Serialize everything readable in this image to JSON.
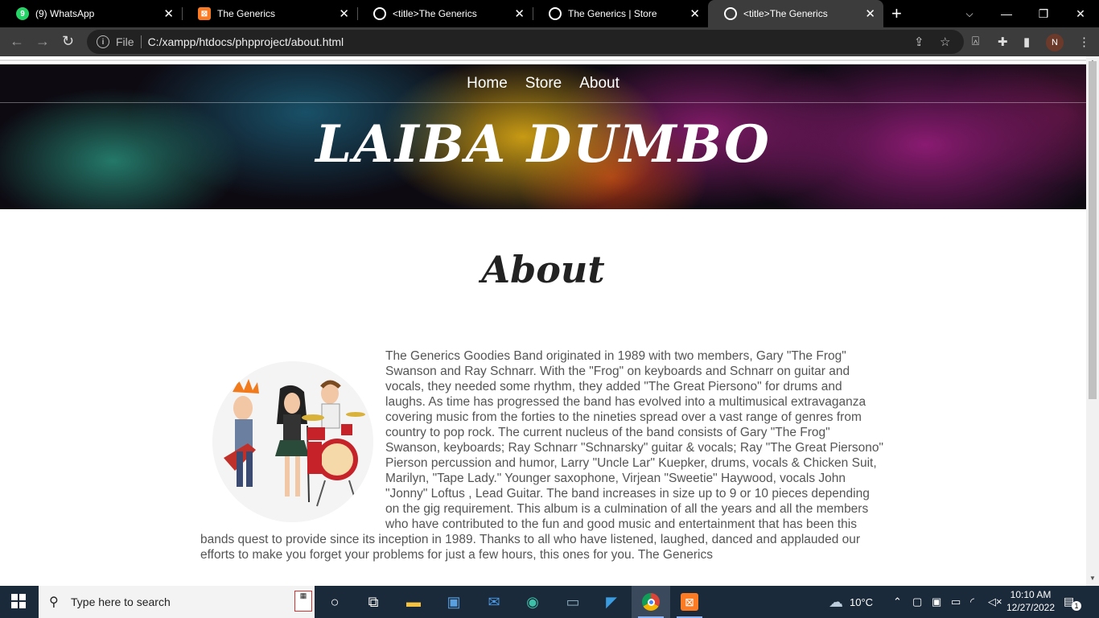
{
  "browser": {
    "tabs": [
      {
        "title": "(9) WhatsApp",
        "badge": "9",
        "favicon": "whatsapp-icon"
      },
      {
        "title": "The Generics",
        "favicon": "xampp-icon"
      },
      {
        "title": "<title>The Generics",
        "favicon": "globe-icon"
      },
      {
        "title": "The Generics | Store",
        "favicon": "globe-icon"
      },
      {
        "title": "<title>The Generics",
        "favicon": "globe-icon"
      }
    ],
    "address": {
      "scheme_label": "File",
      "url": "C:/xampp/htdocs/phpproject/about.html"
    },
    "profile_initial": "N"
  },
  "page": {
    "nav": {
      "home": "Home",
      "store": "Store",
      "about": "About"
    },
    "hero_title": "LAIBA DUMBO",
    "section_title": "About",
    "about_text": "The Generics Goodies Band originated in 1989 with two members, Gary \"The Frog\" Swanson and Ray Schnarr. With the \"Frog\" on keyboards and Schnarr on guitar and vocals, they needed some rhythm, they added \"The Great Piersono\" for drums and laughs. As time has progressed the band has evolved into a multimusical extravaganza covering music from the forties to the nineties spread over a vast range of genres from country to pop rock. The current nucleus of the band consists of Gary \"The Frog\" Swanson, keyboards; Ray Schnarr \"Schnarsky\" guitar & vocals; Ray \"The Great Piersono\" Pierson percussion and humor, Larry \"Uncle Lar\" Kuepker, drums, vocals & Chicken Suit, Marilyn, \"Tape Lady.\" Younger saxophone, Virjean \"Sweetie\" Haywood, vocals John \"Jonny\" Loftus , Lead Guitar. The band increases in size up to 9 or 10 pieces depending on the gig requirement. This album is a culmination of all the years and all the members who have contributed to the fun and good music and entertainment that has been this bands quest to provide since its inception in 1989. Thanks to all who have listened, laughed, danced and applauded our efforts to make you forget your problems for just a few hours, this ones for you. The Generics"
  },
  "taskbar": {
    "search_placeholder": "Type here to search",
    "weather": "10°C",
    "time": "10:10 AM",
    "date": "12/27/2022",
    "notifications": "1"
  }
}
